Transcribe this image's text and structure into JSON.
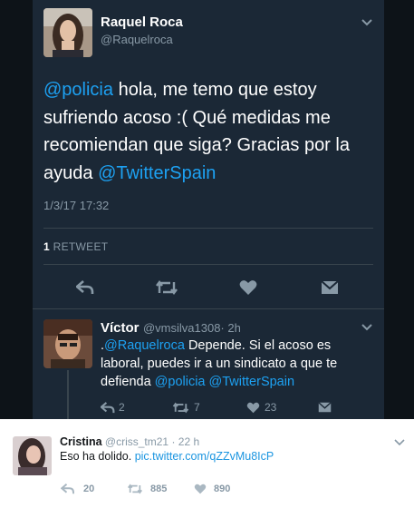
{
  "main_tweet": {
    "author_name": "Raquel Roca",
    "author_handle": "@Raquelroca",
    "text_mention_1": "@policia",
    "text_body": " hola, me temo que estoy sufriendo acoso :( Qué medidas me recomiendan que siga? Gracias por la ayuda ",
    "text_mention_2": "@TwitterSpain",
    "timestamp": "1/3/17 17:32",
    "retweet_count": "1",
    "retweet_label": " RETWEET"
  },
  "reply": {
    "author_name": "Víctor",
    "author_handle": "@vmsilva1308",
    "time": "· 2h",
    "text_prefix": ".",
    "text_mention_1": "@Raquelroca",
    "text_body": " Depende. Si el acoso es laboral, puedes ir a un sindicato a que te defienda ",
    "text_mention_2": "@policia",
    "text_space": " ",
    "text_mention_3": "@TwitterSpain",
    "reply_count": "2",
    "retweet_count": "7",
    "like_count": "23"
  },
  "bottom_tweet": {
    "author_name": "Cristina",
    "author_handle": "@criss_tm21",
    "time": "· 22 h",
    "text": "Eso ha dolido. ",
    "link": "pic.twitter.com/qZZvMu8IcP",
    "reply_count": "20",
    "retweet_count": "885",
    "like_count": "890"
  },
  "colors": {
    "dark_bg": "#0d1318",
    "panel_bg": "#1b2836",
    "mention": "#1da1f2",
    "muted_dark": "#8899a6",
    "muted_light": "#8899a6",
    "link_light": "#1b95e0"
  },
  "icons": [
    "chevron-down-icon",
    "reply-icon",
    "retweet-icon",
    "heart-icon",
    "dm-icon"
  ]
}
